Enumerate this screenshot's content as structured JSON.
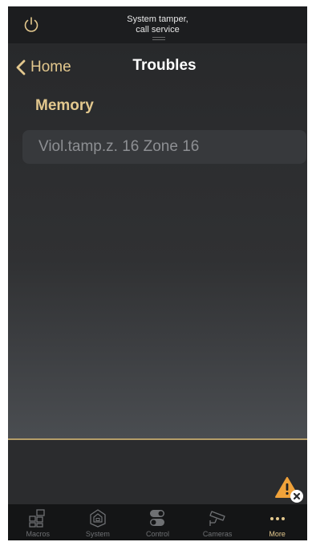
{
  "status_bar": {
    "message": "System tamper,\ncall service"
  },
  "nav": {
    "back_label": "Home",
    "title": "Troubles"
  },
  "section": {
    "title": "Memory",
    "items": [
      {
        "label": "Viol.tamp.z. 16 Zone  16"
      }
    ]
  },
  "tabbar": {
    "tabs": [
      {
        "label": "Macros",
        "icon": "macros-grid-icon"
      },
      {
        "label": "System",
        "icon": "system-house-lock-icon"
      },
      {
        "label": "Control",
        "icon": "control-toggles-icon"
      },
      {
        "label": "Cameras",
        "icon": "camera-icon"
      },
      {
        "label": "More",
        "icon": "more-dots-icon"
      }
    ],
    "active": "More"
  },
  "colors": {
    "accent": "#e3c88e",
    "warning": "#f0a23a"
  }
}
